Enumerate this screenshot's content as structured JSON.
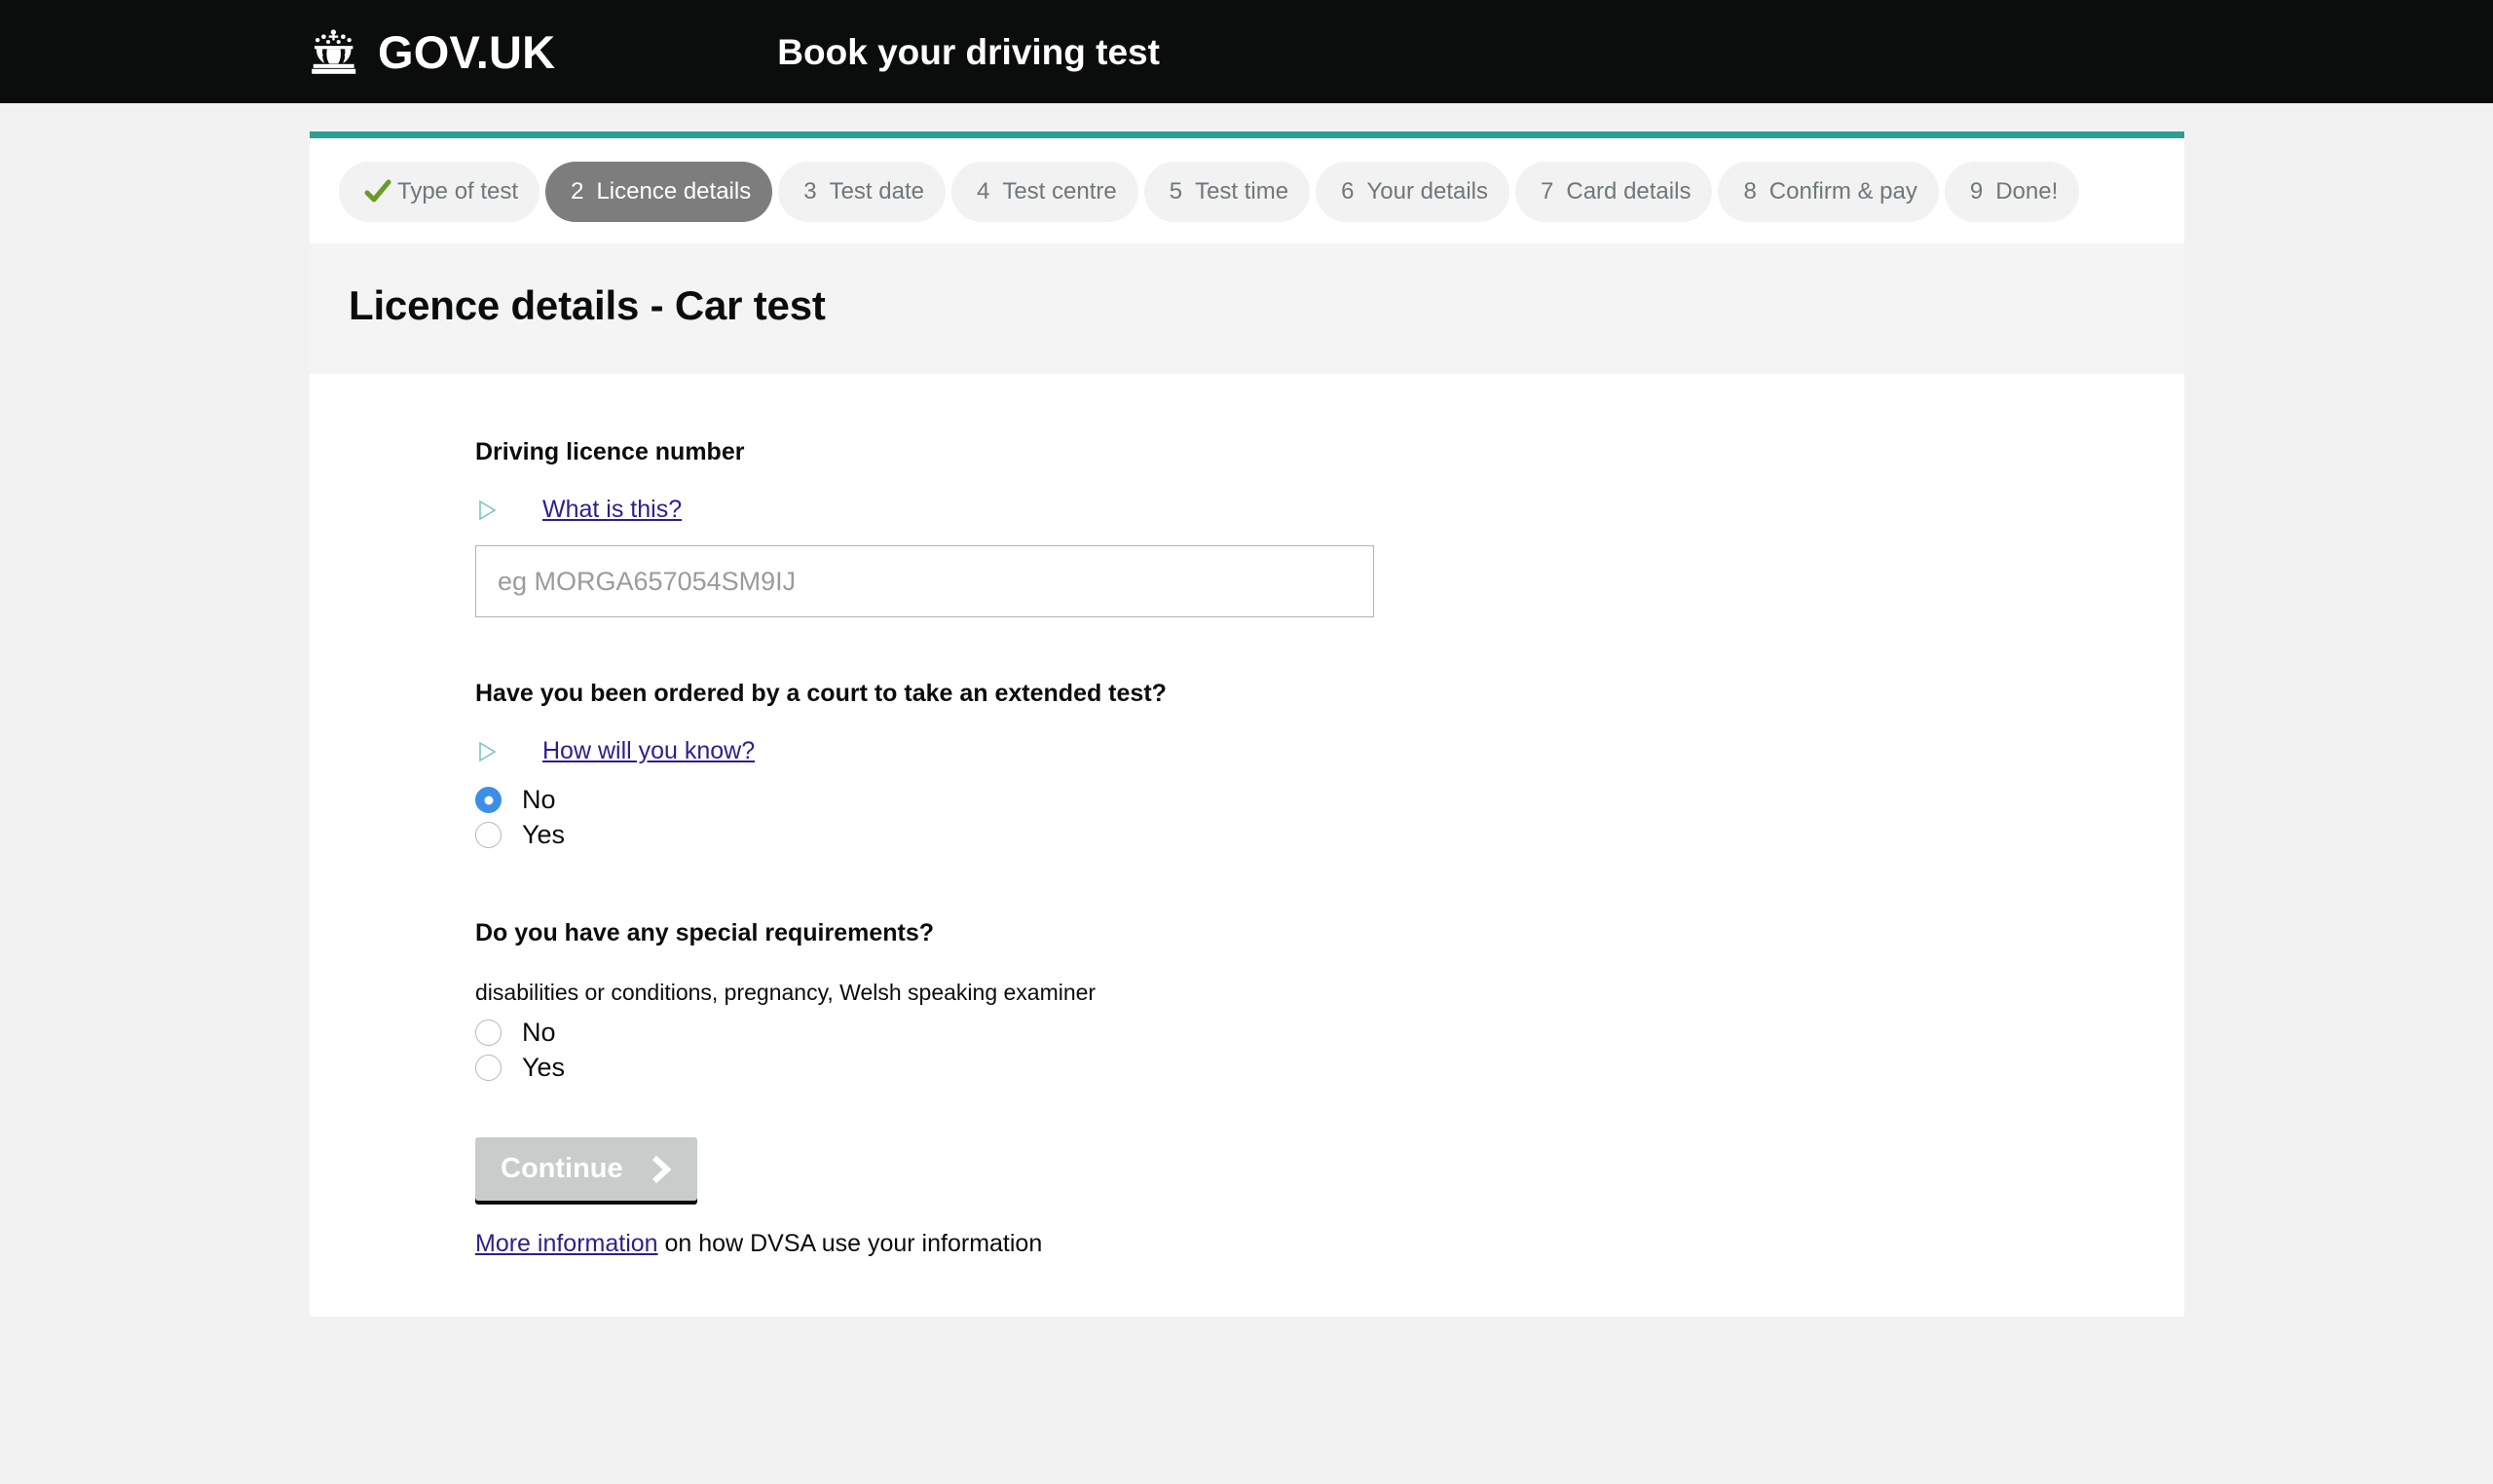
{
  "header": {
    "logo_text": "GOV.UK",
    "crown_icon": "crown-icon",
    "service_title": "Book your driving test"
  },
  "steps": [
    {
      "num": "",
      "label": "Type of test",
      "state": "complete",
      "icon": "check-icon"
    },
    {
      "num": "2",
      "label": "Licence details",
      "state": "current"
    },
    {
      "num": "3",
      "label": "Test date",
      "state": "upcoming"
    },
    {
      "num": "4",
      "label": "Test centre",
      "state": "upcoming"
    },
    {
      "num": "5",
      "label": "Test time",
      "state": "upcoming"
    },
    {
      "num": "6",
      "label": "Your details",
      "state": "upcoming"
    },
    {
      "num": "7",
      "label": "Card details",
      "state": "upcoming"
    },
    {
      "num": "8",
      "label": "Confirm & pay",
      "state": "upcoming"
    },
    {
      "num": "9",
      "label": "Done!",
      "state": "upcoming"
    }
  ],
  "page": {
    "heading": "Licence details - Car test"
  },
  "licence": {
    "label": "Driving licence number",
    "help_link": "What is this?",
    "input_value": "",
    "input_placeholder": "eg MORGA657054SM9IJ"
  },
  "extended_test": {
    "question": "Have you been ordered by a court to take an extended test?",
    "help_link": "How will you know?",
    "options": [
      {
        "label": "No",
        "selected": true
      },
      {
        "label": "Yes",
        "selected": false
      }
    ]
  },
  "special_requirements": {
    "question": "Do you have any special requirements?",
    "hint": "disabilities or conditions, pregnancy, Welsh speaking examiner",
    "options": [
      {
        "label": "No",
        "selected": false
      },
      {
        "label": "Yes",
        "selected": false
      }
    ]
  },
  "actions": {
    "continue_label": "Continue",
    "continue_disabled": true
  },
  "footer": {
    "link_text": "More information",
    "rest_text": " on how DVSA use your information"
  },
  "colors": {
    "header_bg": "#0b0c0c",
    "accent_teal": "#2e9e92",
    "step_current_bg": "#7d7d7d",
    "step_bg": "#f2f2f2",
    "link": "#2e1f8f",
    "radio_selected": "#3b8fe8",
    "check_green": "#6a9a28",
    "button_disabled": "#c8ccca"
  }
}
